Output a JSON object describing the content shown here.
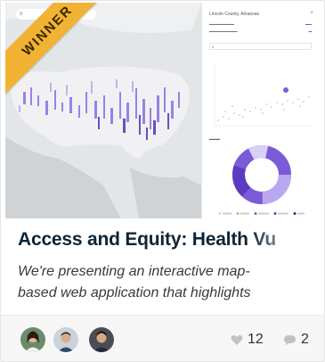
{
  "card": {
    "badge": "WINNER",
    "title": "Access and Equity: Health Vu",
    "description_lines": [
      "We're presenting an interactive map-",
      "based web application that highlights"
    ],
    "likes": "12",
    "comments": "2"
  },
  "thumbnail": {
    "panel_title": "Lincoln County, Arkansas",
    "accent_color": "#7b5bd6",
    "ribbon_color": "#f2b233"
  },
  "avatars": [
    "user-avatar-1",
    "user-avatar-2",
    "user-avatar-3"
  ]
}
